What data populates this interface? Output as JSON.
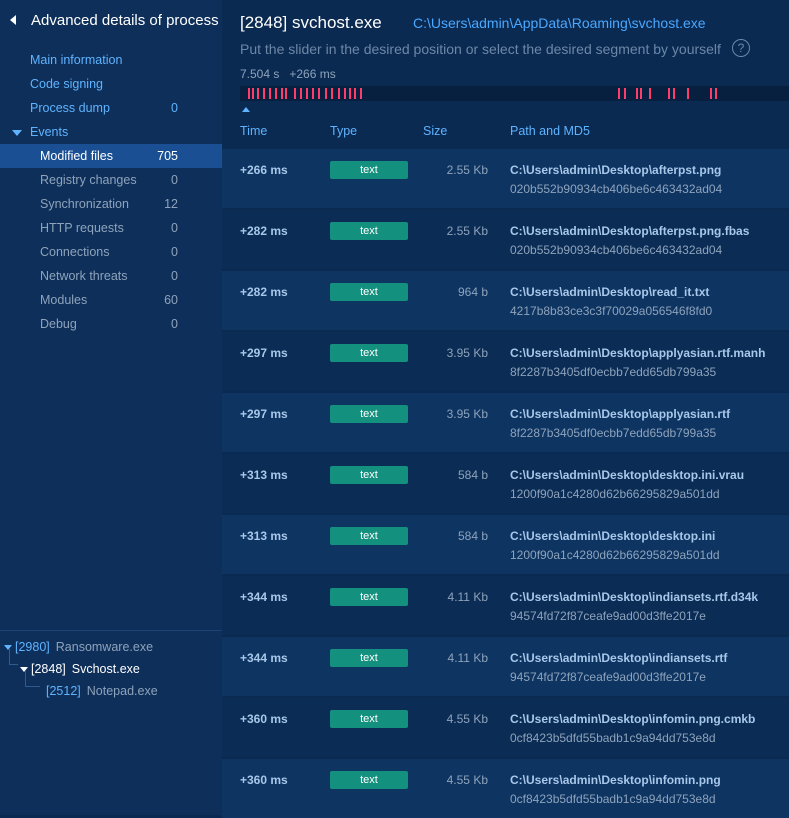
{
  "sidebar": {
    "title": "Advanced details of process",
    "top_items": [
      {
        "label": "Main information",
        "count": ""
      },
      {
        "label": "Code signing",
        "count": ""
      },
      {
        "label": "Process dump",
        "count": "0"
      },
      {
        "label": "Events",
        "count": ""
      }
    ],
    "events": [
      {
        "label": "Modified files",
        "count": "705"
      },
      {
        "label": "Registry changes",
        "count": "0"
      },
      {
        "label": "Synchronization",
        "count": "12"
      },
      {
        "label": "HTTP requests",
        "count": "0"
      },
      {
        "label": "Connections",
        "count": "0"
      },
      {
        "label": "Network threats",
        "count": "0"
      },
      {
        "label": "Modules",
        "count": "60"
      },
      {
        "label": "Debug",
        "count": "0"
      }
    ]
  },
  "tree": [
    {
      "pid": "[2980]",
      "name": "Ransomware.exe"
    },
    {
      "pid": "[2848]",
      "name": "Svchost.exe"
    },
    {
      "pid": "[2512]",
      "name": "Notepad.exe"
    }
  ],
  "header": {
    "title": "[2848] svchost.exe",
    "path": "C:\\Users\\admin\\AppData\\Roaming\\svchost.exe",
    "hint": "Put the slider in the desired position or select the desired segment by yourself",
    "help": "?",
    "time_total": "7.504 s",
    "time_offset": "+266 ms"
  },
  "colors": {
    "accent": "#5fb3ff",
    "badge": "#14907e",
    "tick": "#ff3d6b"
  },
  "table": {
    "columns": [
      "Time",
      "Type",
      "Size",
      "Path and MD5"
    ],
    "rows": [
      {
        "time": "+266 ms",
        "type": "text",
        "size": "2.55 Kb",
        "path": "C:\\Users\\admin\\Desktop\\afterpst.png",
        "md5": "020b552b90934cb406be6c463432ad04"
      },
      {
        "time": "+282 ms",
        "type": "text",
        "size": "2.55 Kb",
        "path": "C:\\Users\\admin\\Desktop\\afterpst.png.fbas",
        "md5": "020b552b90934cb406be6c463432ad04"
      },
      {
        "time": "+282 ms",
        "type": "text",
        "size": "964 b",
        "path": "C:\\Users\\admin\\Desktop\\read_it.txt",
        "md5": "4217b8b83ce3c3f70029a056546f8fd0"
      },
      {
        "time": "+297 ms",
        "type": "text",
        "size": "3.95 Kb",
        "path": "C:\\Users\\admin\\Desktop\\applyasian.rtf.manh",
        "md5": "8f2287b3405df0ecbb7edd65db799a35"
      },
      {
        "time": "+297 ms",
        "type": "text",
        "size": "3.95 Kb",
        "path": "C:\\Users\\admin\\Desktop\\applyasian.rtf",
        "md5": "8f2287b3405df0ecbb7edd65db799a35"
      },
      {
        "time": "+313 ms",
        "type": "text",
        "size": "584 b",
        "path": "C:\\Users\\admin\\Desktop\\desktop.ini.vrau",
        "md5": "1200f90a1c4280d62b66295829a501dd"
      },
      {
        "time": "+313 ms",
        "type": "text",
        "size": "584 b",
        "path": "C:\\Users\\admin\\Desktop\\desktop.ini",
        "md5": "1200f90a1c4280d62b66295829a501dd"
      },
      {
        "time": "+344 ms",
        "type": "text",
        "size": "4.11 Kb",
        "path": "C:\\Users\\admin\\Desktop\\indiansets.rtf.d34k",
        "md5": "94574fd72f87ceafe9ad00d3ffe2017e"
      },
      {
        "time": "+344 ms",
        "type": "text",
        "size": "4.11 Kb",
        "path": "C:\\Users\\admin\\Desktop\\indiansets.rtf",
        "md5": "94574fd72f87ceafe9ad00d3ffe2017e"
      },
      {
        "time": "+360 ms",
        "type": "text",
        "size": "4.55 Kb",
        "path": "C:\\Users\\admin\\Desktop\\infomin.png.cmkb",
        "md5": "0cf8423b5dfd55badb1c9a94dd753e8d"
      },
      {
        "time": "+360 ms",
        "type": "text",
        "size": "4.55 Kb",
        "path": "C:\\Users\\admin\\Desktop\\infomin.png",
        "md5": "0cf8423b5dfd55badb1c9a94dd753e8d"
      }
    ]
  }
}
